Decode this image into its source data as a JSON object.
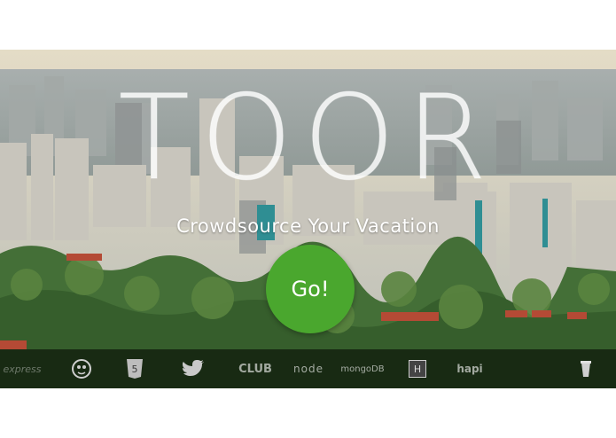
{
  "brand": {
    "title": "TOOR"
  },
  "hero": {
    "tagline": "Crowdsource Your Vacation"
  },
  "cta": {
    "label": "Go!"
  },
  "tech_logos": [
    {
      "name": "express-icon",
      "text": "express"
    },
    {
      "name": "monkey-icon",
      "text": ""
    },
    {
      "name": "html5-icon",
      "text": "5"
    },
    {
      "name": "twitter-icon",
      "text": ""
    },
    {
      "name": "club-icon",
      "text": "CLUB"
    },
    {
      "name": "node-icon",
      "text": "node"
    },
    {
      "name": "mongodb-icon",
      "text": "mongoDB"
    },
    {
      "name": "heroku-icon",
      "text": "H"
    },
    {
      "name": "hapi-icon",
      "text": "hapi"
    },
    {
      "name": "cup-icon",
      "text": ""
    }
  ],
  "colors": {
    "go_button": "#4aa72e",
    "sky": "#d8d0bc",
    "foliage": "#3f6b34"
  }
}
